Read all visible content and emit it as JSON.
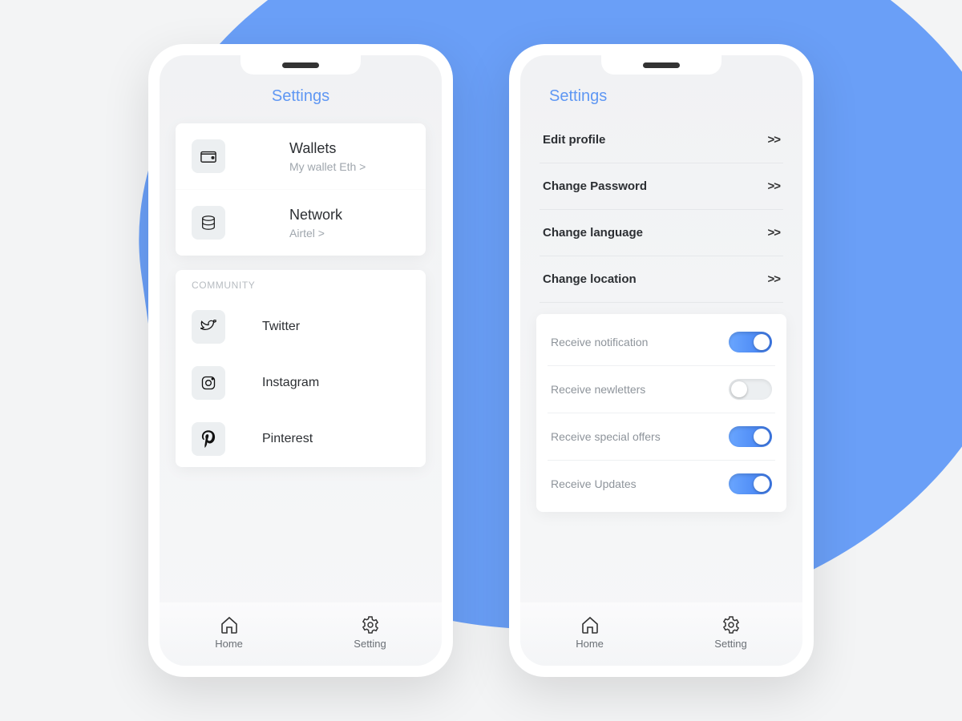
{
  "left": {
    "title": "Settings",
    "wallet_title": "Wallets",
    "wallet_sub": "My wallet Eth >",
    "network_title": "Network",
    "network_sub": "Airtel >",
    "community_label": "COMMUNITY",
    "twitter": "Twitter",
    "instagram": "Instagram",
    "pinterest": "Pinterest"
  },
  "right": {
    "title": "Settings",
    "items": {
      "edit_profile": "Edit profile",
      "change_password": "Change Password",
      "change_language": "Change language",
      "change_location": "Change location"
    },
    "chevron": ">>",
    "toggles": {
      "notification": "Receive notification",
      "newsletters": "Receive newletters",
      "offers": "Receive special offers",
      "updates": "Receive Updates"
    }
  },
  "tabs": {
    "home": "Home",
    "setting": "Setting"
  },
  "colors": {
    "accent": "#5f97f3"
  }
}
